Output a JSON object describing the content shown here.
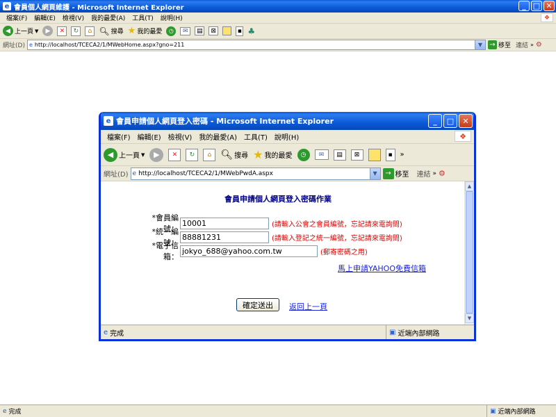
{
  "outer": {
    "title": "會員個人網頁維護 - Microsoft Internet Explorer",
    "menu": [
      "檔案(F)",
      "編輯(E)",
      "檢視(V)",
      "我的最愛(A)",
      "工具(T)",
      "說明(H)"
    ],
    "toolbar": {
      "back": "上一頁",
      "search": "搜尋",
      "favorites": "我的最愛"
    },
    "address_label": "網址(D)",
    "address": "http://localhost/TCECA2/1/MWebHome.aspx?gno=211",
    "go": "移至",
    "links": "連結",
    "status": "完成",
    "zone": "近端內部網路"
  },
  "popup": {
    "title": "會員申請個人網頁登入密碼 - Microsoft Internet Explorer",
    "menu": [
      "檔案(F)",
      "編輯(E)",
      "檢視(V)",
      "我的最愛(A)",
      "工具(T)",
      "說明(H)"
    ],
    "toolbar": {
      "back": "上一頁",
      "search": "搜尋",
      "favorites": "我的最愛"
    },
    "address_label": "網址(D)",
    "address": "http://localhost/TCECA2/1/MWebPwdA.aspx",
    "go": "移至",
    "links": "連結",
    "status": "完成",
    "zone": "近端內部網路"
  },
  "form": {
    "title": "會員申請個人網頁登入密碼作業",
    "member_label": "*會員編號：",
    "member_value": "10001",
    "member_hint": "(請輸入公會之會員編號，忘記請來電詢問)",
    "tax_label": "*統一編號：",
    "tax_value": "88881231",
    "tax_hint": "(請輸入登記之統一編號，忘記請來電詢問)",
    "email_label": "*電子信箱：",
    "email_value": "jokyo_688@yahoo.com.tw",
    "email_hint": "(郵寄密碼之用)",
    "yahoo_link": "馬上申請YAHOO免費信箱",
    "submit": "確定送出",
    "back_link": "返回上一頁"
  }
}
